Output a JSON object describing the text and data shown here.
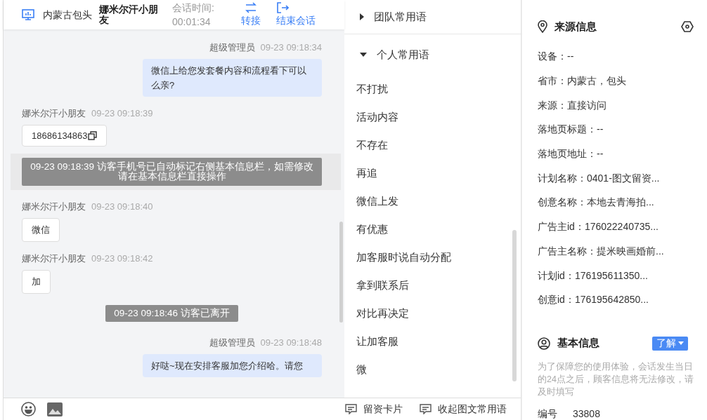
{
  "header": {
    "location": "内蒙古包头",
    "visitor": "娜米尔汗小朋友",
    "duration_label": "会话时间:",
    "duration": "00:01:34",
    "actions": [
      {
        "label": "转接",
        "kind": "transfer"
      },
      {
        "label": "结束会话",
        "kind": "end"
      }
    ]
  },
  "messages": [
    {
      "kind": "agent",
      "sender": "超级管理员",
      "time": "09-23 09:18:34",
      "text": "微信上给您发套餐内容和流程看下可以么亲?"
    },
    {
      "kind": "visitor",
      "sender": "娜米尔汗小朋友",
      "time": "09-23 09:18:39",
      "text": "18686134863",
      "copyable": true
    },
    {
      "kind": "system",
      "text": "09-23 09:18:39 访客手机号已自动标记右侧基本信息栏，如需修改请在基本信息栏直接操作",
      "highlighted": true
    },
    {
      "kind": "visitor",
      "sender": "娜米尔汗小朋友",
      "time": "09-23 09:18:40",
      "text": "微信",
      "copyable": false
    },
    {
      "kind": "visitor",
      "sender": "娜米尔汗小朋友",
      "time": "09-23 09:18:42",
      "text": "加",
      "copyable": false
    },
    {
      "kind": "system",
      "text": "09-23 09:18:46 访客已离开",
      "highlighted": false
    },
    {
      "kind": "agent",
      "sender": "超级管理员",
      "time": "09-23 09:18:48",
      "text": "好哒~现在安排客服加您介绍哈。请您"
    }
  ],
  "phrases": {
    "groups": [
      {
        "title": "团队常用语",
        "expanded": false
      },
      {
        "title": "个人常用语",
        "expanded": true,
        "items": [
          "不打扰",
          "活动内容",
          "不存在",
          "再追",
          "微信上发",
          "有优惠",
          "加客服时说自动分配",
          "拿到联系后",
          "对比再决定",
          "让加客服",
          "微"
        ]
      }
    ],
    "footer": [
      "留资卡片",
      "收起图文常用语"
    ]
  },
  "source_info": {
    "title": "来源信息",
    "fields": [
      "设备：--",
      "省市：内蒙古，包头",
      "来源：直接访问",
      "落地页标题：--",
      "落地页地址：--",
      "计划名称：0401-图文留资...",
      "创意名称：本地去青海拍...",
      "广告主id：176022240735...",
      "广告主名称：提米映画婚前...",
      "计划id：176195611350...",
      "创意id：176195642850..."
    ]
  },
  "basic_info": {
    "title": "基本信息",
    "button": "了解",
    "note": "为了保障您的使用体验，会话发生当日的24点之后，顾客信息将无法修改，请及时填写",
    "fields": [
      {
        "label": "编号",
        "value": "33808"
      }
    ]
  }
}
